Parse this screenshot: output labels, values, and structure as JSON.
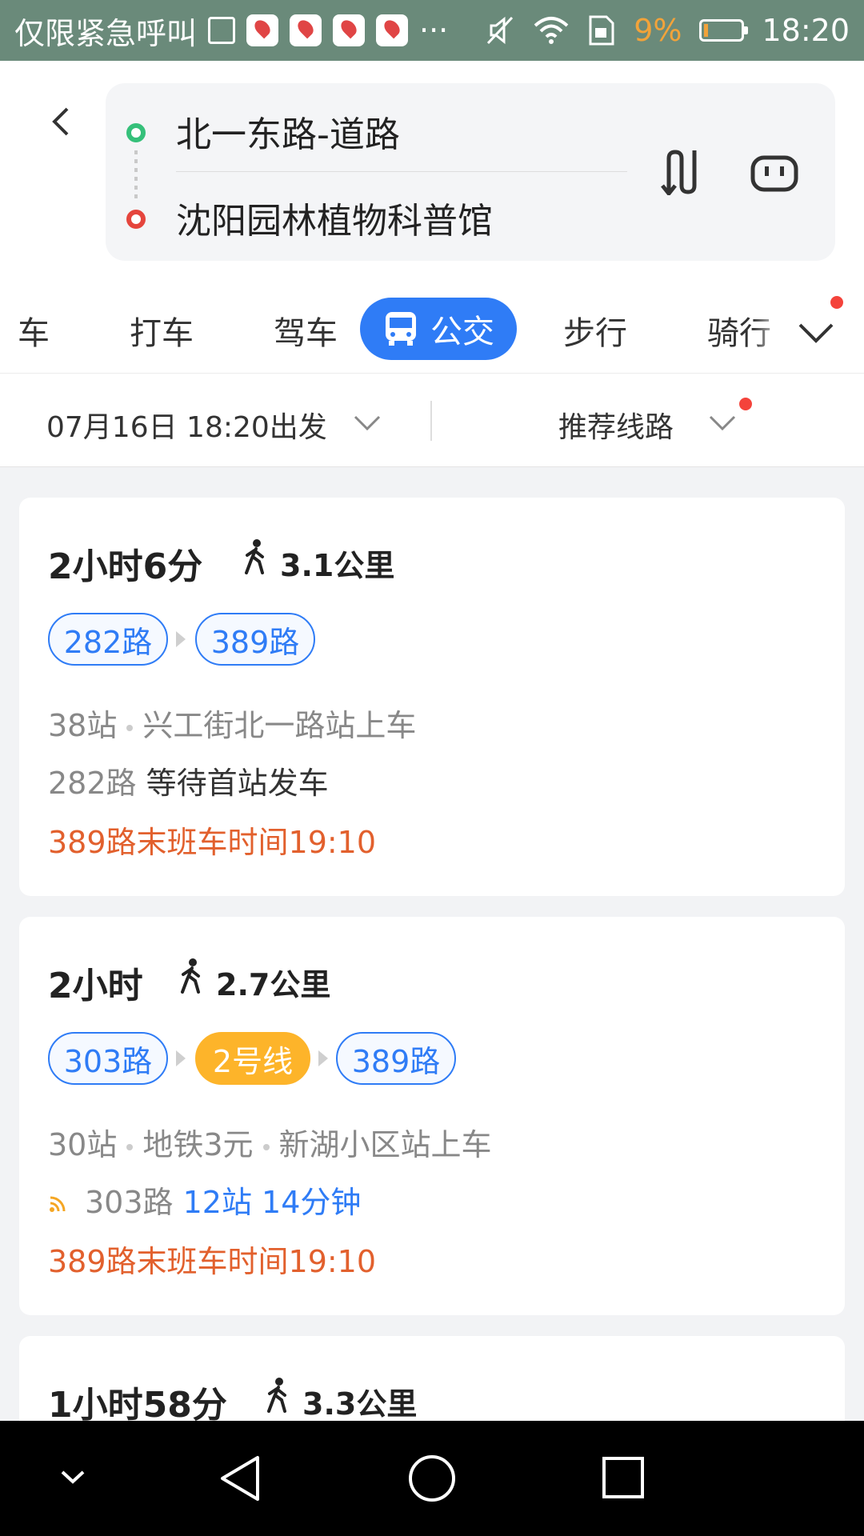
{
  "status_bar": {
    "emergency_text": "仅限紧急呼叫",
    "more": "···",
    "battery_pct": "9%",
    "time": "18:20"
  },
  "route": {
    "from": "北一东路-道路",
    "to": "沈阳园林植物科普馆"
  },
  "tabs": {
    "partial_left": "车",
    "taxi": "打车",
    "drive": "驾车",
    "bus": "公交",
    "walk": "步行",
    "ride": "骑行"
  },
  "filter": {
    "time": "07月16日 18:20出发",
    "sort": "推荐线路"
  },
  "routes": [
    {
      "duration": "2小时6分",
      "walk": "3.1公里",
      "lines": [
        "282路",
        "389路"
      ],
      "stops": "38站",
      "board": "兴工街北一路站上车",
      "status_line": "282路",
      "status_text": "等待首站发车",
      "last_bus": "389路末班车时间19:10"
    },
    {
      "duration": "2小时",
      "walk": "2.7公里",
      "lines": [
        "303路",
        "2号线",
        "389路"
      ],
      "stops": "30站",
      "fare": "地铁3元",
      "board": "新湖小区站上车",
      "status_line": "303路",
      "status_text": "12站 14分钟",
      "last_bus": "389路末班车时间19:10"
    },
    {
      "duration": "1小时58分",
      "walk": "3.3公里"
    }
  ],
  "colors": {
    "accent": "#2f7cf6",
    "metro": "#fdb42a",
    "warning": "#e2602d",
    "start_dot": "#35c07a",
    "end_dot": "#e5453d"
  }
}
